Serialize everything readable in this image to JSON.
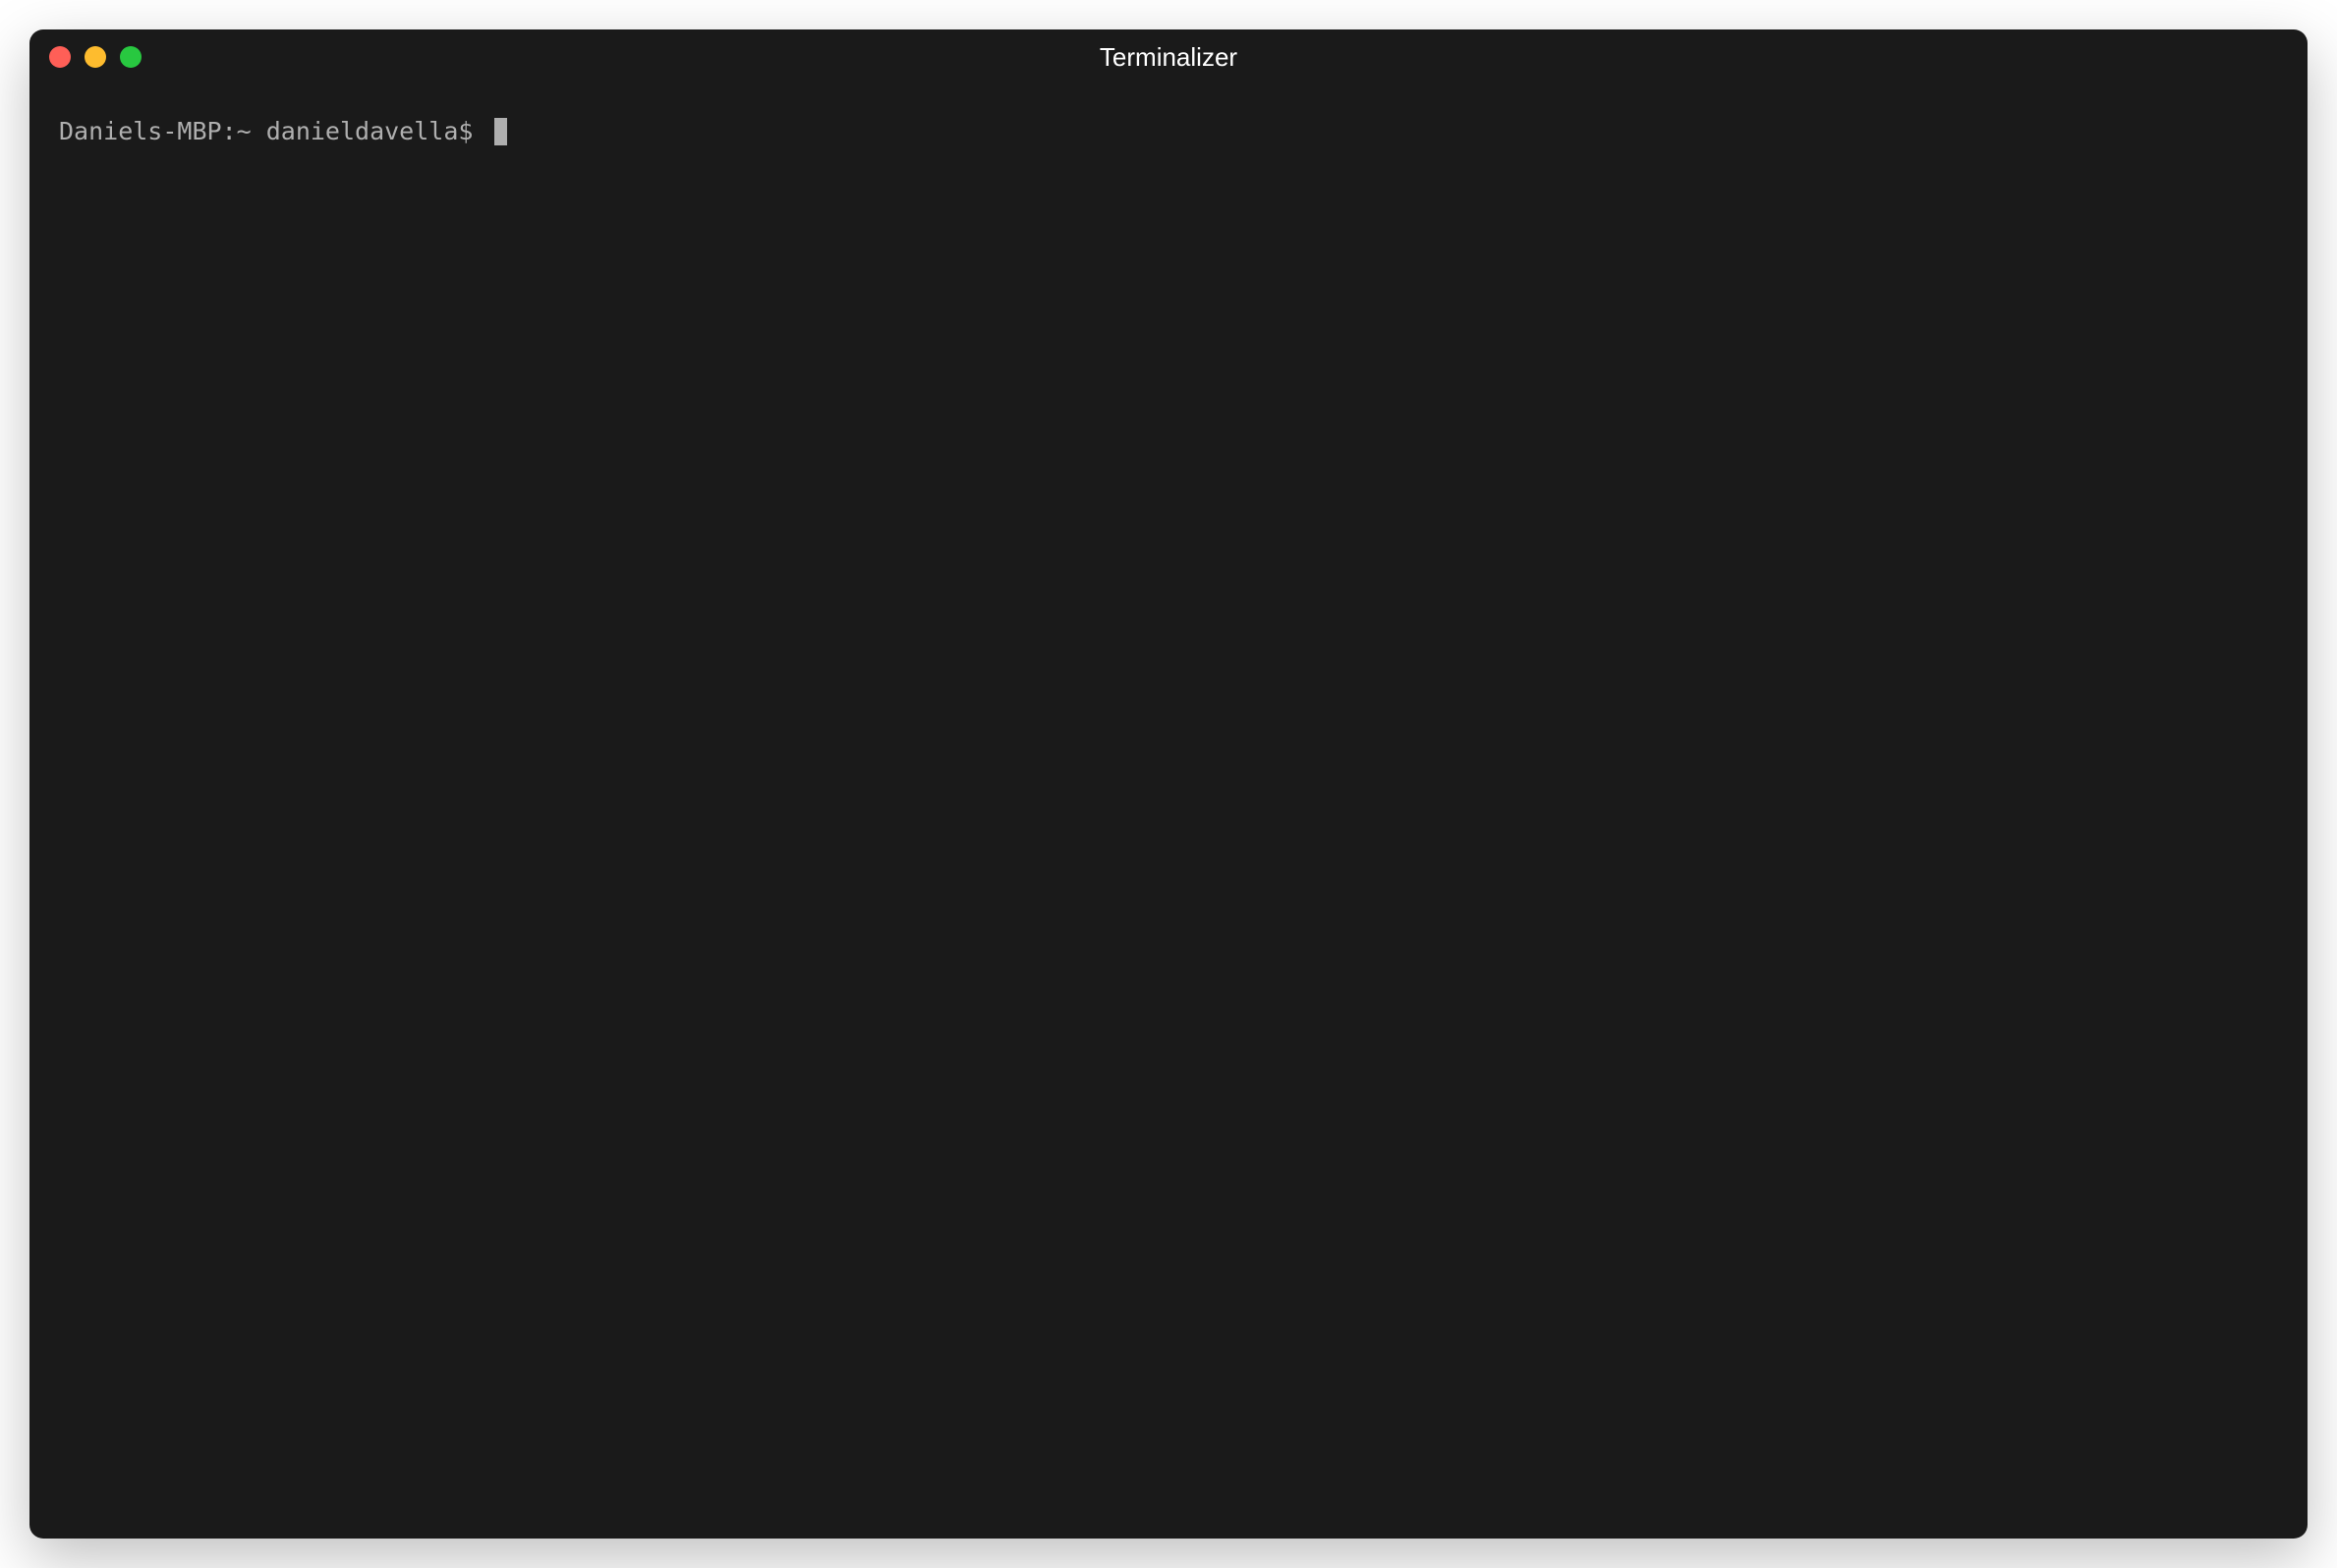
{
  "window": {
    "title": "Terminalizer"
  },
  "terminal": {
    "prompt": "Daniels-MBP:~ danieldavella$ "
  }
}
